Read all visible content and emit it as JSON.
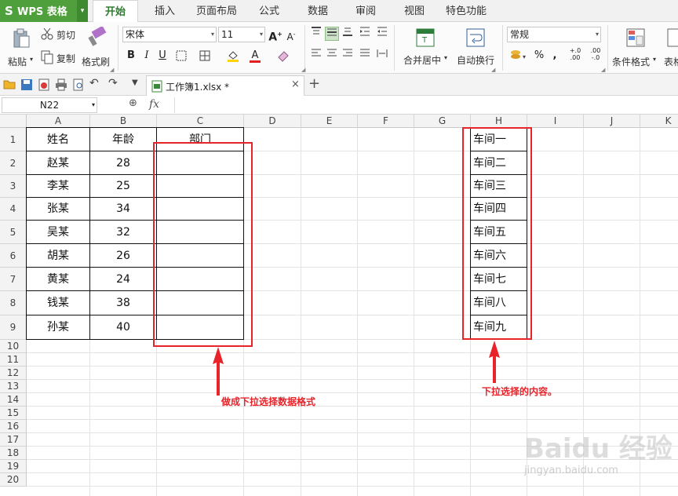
{
  "app": {
    "name": "WPS 表格"
  },
  "menu": {
    "tabs": [
      "开始",
      "插入",
      "页面布局",
      "公式",
      "数据",
      "审阅",
      "视图",
      "特色功能"
    ]
  },
  "ribbon": {
    "paste": "粘贴",
    "cut": "剪切",
    "copy": "复制",
    "format_painter": "格式刷",
    "font_name": "宋体",
    "font_size": "11",
    "merge_center": "合并居中",
    "auto_wrap": "自动换行",
    "number_format": "常规",
    "conditional_format": "条件格式",
    "table_style": "表格"
  },
  "document": {
    "tab_title": "工作簿1.xlsx *"
  },
  "formula_bar": {
    "name_box": "N22",
    "fx": "fx"
  },
  "sheet": {
    "columns": [
      "A",
      "B",
      "C",
      "D",
      "E",
      "F",
      "G",
      "H",
      "I",
      "J",
      "K"
    ],
    "rows": [
      "1",
      "2",
      "3",
      "4",
      "5",
      "6",
      "7",
      "8",
      "9",
      "10",
      "11",
      "12",
      "13",
      "14",
      "15",
      "16",
      "17",
      "18",
      "19",
      "20"
    ],
    "header": {
      "a": "姓名",
      "b": "年龄",
      "c": "部门"
    },
    "names": [
      "赵某",
      "李某",
      "张某",
      "吴某",
      "胡某",
      "黄某",
      "钱某",
      "孙某"
    ],
    "ages": [
      "28",
      "25",
      "34",
      "32",
      "26",
      "24",
      "38",
      "40"
    ],
    "workshops": [
      "车间一",
      "车间二",
      "车间三",
      "车间四",
      "车间五",
      "车间六",
      "车间七",
      "车间八",
      "车间九"
    ]
  },
  "annotations": {
    "left": "做成下拉选择数据格式",
    "right": "下拉选择的内容。"
  },
  "watermark": {
    "line1": "Baidu 经验",
    "line2": "jingyan.baidu.com"
  },
  "colors": {
    "accent": "#4f9f3d",
    "annotation": "#e8232a"
  }
}
